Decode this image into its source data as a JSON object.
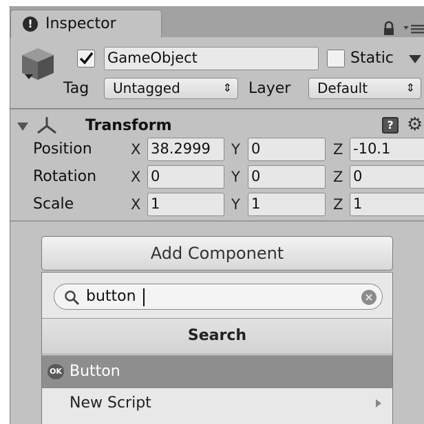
{
  "tab": {
    "title": "Inspector",
    "info_icon": "info-icon",
    "lock_icon": "lock-icon",
    "menu_icon": "menu-icon"
  },
  "object": {
    "icon": "cube-icon",
    "active": true,
    "name": "GameObject",
    "static_label": "Static",
    "static_checked": false,
    "tag_label": "Tag",
    "tag_value": "Untagged",
    "layer_label": "Layer",
    "layer_value": "Default"
  },
  "transform": {
    "title": "Transform",
    "collapse_icon": "triangle-down-icon",
    "axes_icon": "transform-axes-icon",
    "help_icon": "help-book-icon",
    "settings_icon": "gear-icon",
    "axis_x": "X",
    "axis_y": "Y",
    "axis_z": "Z",
    "rows": [
      {
        "label": "Position",
        "x": "38.2999",
        "y": "0",
        "z": "-10.1"
      },
      {
        "label": "Rotation",
        "x": "0",
        "y": "0",
        "z": "0"
      },
      {
        "label": "Scale",
        "x": "1",
        "y": "1",
        "z": "1"
      }
    ]
  },
  "add_component": {
    "button_label": "Add Component",
    "search_value": "button",
    "search_icon": "search-icon",
    "clear_icon": "clear-icon",
    "header": "Search",
    "items": [
      {
        "label": "Button",
        "icon": "ok-button-icon",
        "selected": true
      },
      {
        "label": "New Script",
        "icon": "arrow-right-icon",
        "selected": false
      }
    ]
  }
}
